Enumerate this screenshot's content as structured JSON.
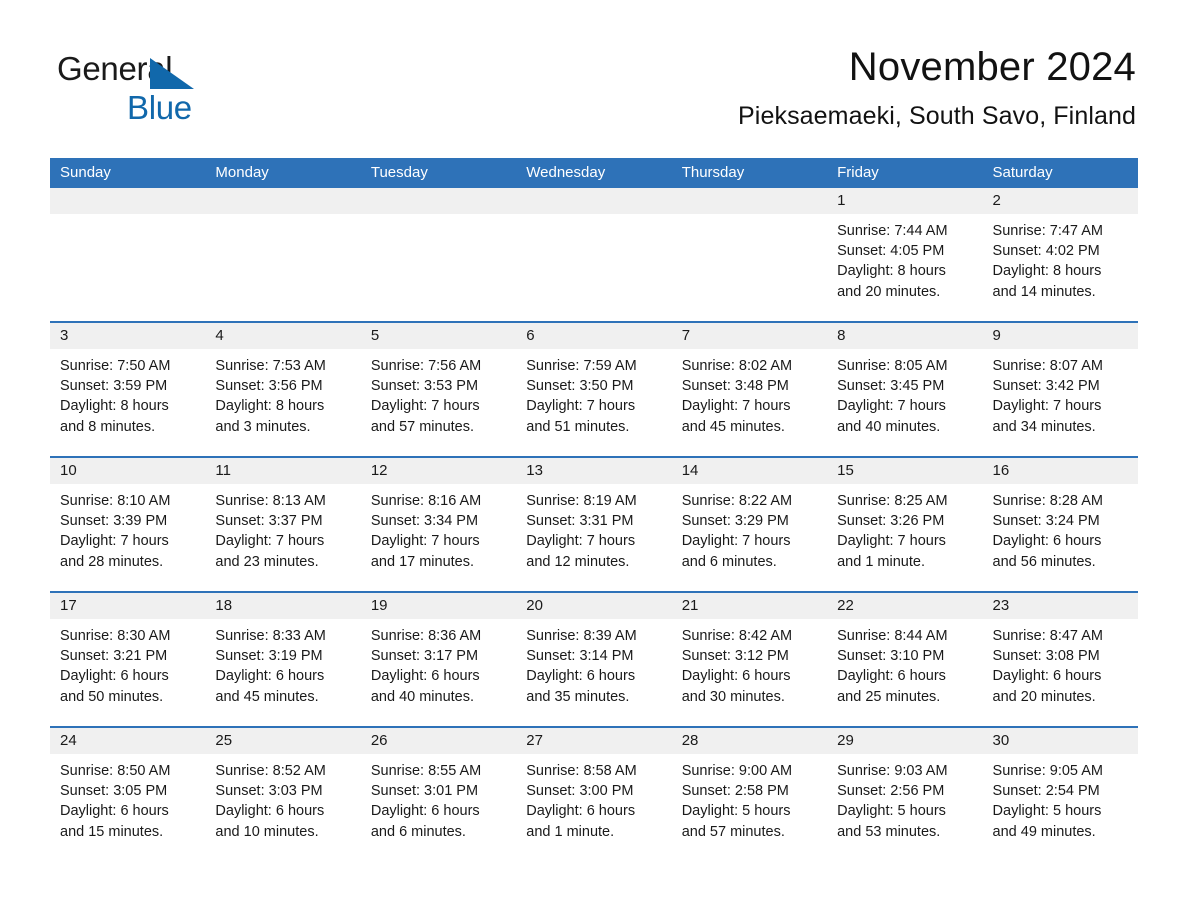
{
  "brand": {
    "word1": "General",
    "word2": "Blue",
    "accent_color": "#1168ab",
    "triangle_icon": "brand-triangle-icon"
  },
  "header": {
    "title": "November 2024",
    "subtitle": "Pieksaemaeki, South Savo, Finland"
  },
  "theme": {
    "header_blue": "#2e72b8",
    "row_divider_blue": "#2e72b8",
    "daynum_band_gray": "#f0f0f0",
    "text_color": "#1a1a1a",
    "header_text_color": "#ffffff"
  },
  "weekdays": [
    "Sunday",
    "Monday",
    "Tuesday",
    "Wednesday",
    "Thursday",
    "Friday",
    "Saturday"
  ],
  "weeks": [
    [
      {
        "day": "",
        "lines": []
      },
      {
        "day": "",
        "lines": []
      },
      {
        "day": "",
        "lines": []
      },
      {
        "day": "",
        "lines": []
      },
      {
        "day": "",
        "lines": []
      },
      {
        "day": "1",
        "lines": [
          "Sunrise: 7:44 AM",
          "Sunset: 4:05 PM",
          "Daylight: 8 hours",
          "and 20 minutes."
        ]
      },
      {
        "day": "2",
        "lines": [
          "Sunrise: 7:47 AM",
          "Sunset: 4:02 PM",
          "Daylight: 8 hours",
          "and 14 minutes."
        ]
      }
    ],
    [
      {
        "day": "3",
        "lines": [
          "Sunrise: 7:50 AM",
          "Sunset: 3:59 PM",
          "Daylight: 8 hours",
          "and 8 minutes."
        ]
      },
      {
        "day": "4",
        "lines": [
          "Sunrise: 7:53 AM",
          "Sunset: 3:56 PM",
          "Daylight: 8 hours",
          "and 3 minutes."
        ]
      },
      {
        "day": "5",
        "lines": [
          "Sunrise: 7:56 AM",
          "Sunset: 3:53 PM",
          "Daylight: 7 hours",
          "and 57 minutes."
        ]
      },
      {
        "day": "6",
        "lines": [
          "Sunrise: 7:59 AM",
          "Sunset: 3:50 PM",
          "Daylight: 7 hours",
          "and 51 minutes."
        ]
      },
      {
        "day": "7",
        "lines": [
          "Sunrise: 8:02 AM",
          "Sunset: 3:48 PM",
          "Daylight: 7 hours",
          "and 45 minutes."
        ]
      },
      {
        "day": "8",
        "lines": [
          "Sunrise: 8:05 AM",
          "Sunset: 3:45 PM",
          "Daylight: 7 hours",
          "and 40 minutes."
        ]
      },
      {
        "day": "9",
        "lines": [
          "Sunrise: 8:07 AM",
          "Sunset: 3:42 PM",
          "Daylight: 7 hours",
          "and 34 minutes."
        ]
      }
    ],
    [
      {
        "day": "10",
        "lines": [
          "Sunrise: 8:10 AM",
          "Sunset: 3:39 PM",
          "Daylight: 7 hours",
          "and 28 minutes."
        ]
      },
      {
        "day": "11",
        "lines": [
          "Sunrise: 8:13 AM",
          "Sunset: 3:37 PM",
          "Daylight: 7 hours",
          "and 23 minutes."
        ]
      },
      {
        "day": "12",
        "lines": [
          "Sunrise: 8:16 AM",
          "Sunset: 3:34 PM",
          "Daylight: 7 hours",
          "and 17 minutes."
        ]
      },
      {
        "day": "13",
        "lines": [
          "Sunrise: 8:19 AM",
          "Sunset: 3:31 PM",
          "Daylight: 7 hours",
          "and 12 minutes."
        ]
      },
      {
        "day": "14",
        "lines": [
          "Sunrise: 8:22 AM",
          "Sunset: 3:29 PM",
          "Daylight: 7 hours",
          "and 6 minutes."
        ]
      },
      {
        "day": "15",
        "lines": [
          "Sunrise: 8:25 AM",
          "Sunset: 3:26 PM",
          "Daylight: 7 hours",
          "and 1 minute."
        ]
      },
      {
        "day": "16",
        "lines": [
          "Sunrise: 8:28 AM",
          "Sunset: 3:24 PM",
          "Daylight: 6 hours",
          "and 56 minutes."
        ]
      }
    ],
    [
      {
        "day": "17",
        "lines": [
          "Sunrise: 8:30 AM",
          "Sunset: 3:21 PM",
          "Daylight: 6 hours",
          "and 50 minutes."
        ]
      },
      {
        "day": "18",
        "lines": [
          "Sunrise: 8:33 AM",
          "Sunset: 3:19 PM",
          "Daylight: 6 hours",
          "and 45 minutes."
        ]
      },
      {
        "day": "19",
        "lines": [
          "Sunrise: 8:36 AM",
          "Sunset: 3:17 PM",
          "Daylight: 6 hours",
          "and 40 minutes."
        ]
      },
      {
        "day": "20",
        "lines": [
          "Sunrise: 8:39 AM",
          "Sunset: 3:14 PM",
          "Daylight: 6 hours",
          "and 35 minutes."
        ]
      },
      {
        "day": "21",
        "lines": [
          "Sunrise: 8:42 AM",
          "Sunset: 3:12 PM",
          "Daylight: 6 hours",
          "and 30 minutes."
        ]
      },
      {
        "day": "22",
        "lines": [
          "Sunrise: 8:44 AM",
          "Sunset: 3:10 PM",
          "Daylight: 6 hours",
          "and 25 minutes."
        ]
      },
      {
        "day": "23",
        "lines": [
          "Sunrise: 8:47 AM",
          "Sunset: 3:08 PM",
          "Daylight: 6 hours",
          "and 20 minutes."
        ]
      }
    ],
    [
      {
        "day": "24",
        "lines": [
          "Sunrise: 8:50 AM",
          "Sunset: 3:05 PM",
          "Daylight: 6 hours",
          "and 15 minutes."
        ]
      },
      {
        "day": "25",
        "lines": [
          "Sunrise: 8:52 AM",
          "Sunset: 3:03 PM",
          "Daylight: 6 hours",
          "and 10 minutes."
        ]
      },
      {
        "day": "26",
        "lines": [
          "Sunrise: 8:55 AM",
          "Sunset: 3:01 PM",
          "Daylight: 6 hours",
          "and 6 minutes."
        ]
      },
      {
        "day": "27",
        "lines": [
          "Sunrise: 8:58 AM",
          "Sunset: 3:00 PM",
          "Daylight: 6 hours",
          "and 1 minute."
        ]
      },
      {
        "day": "28",
        "lines": [
          "Sunrise: 9:00 AM",
          "Sunset: 2:58 PM",
          "Daylight: 5 hours",
          "and 57 minutes."
        ]
      },
      {
        "day": "29",
        "lines": [
          "Sunrise: 9:03 AM",
          "Sunset: 2:56 PM",
          "Daylight: 5 hours",
          "and 53 minutes."
        ]
      },
      {
        "day": "30",
        "lines": [
          "Sunrise: 9:05 AM",
          "Sunset: 2:54 PM",
          "Daylight: 5 hours",
          "and 49 minutes."
        ]
      }
    ]
  ]
}
